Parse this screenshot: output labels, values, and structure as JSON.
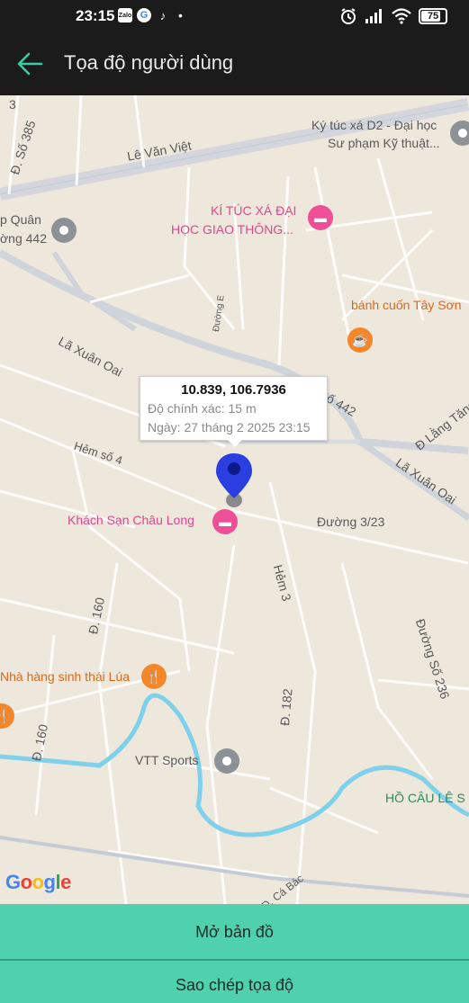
{
  "status_bar": {
    "time": "23:15",
    "app_icons": [
      "zalo-icon",
      "google-icon",
      "tiktok-icon"
    ],
    "zalo_label": "Zalo",
    "google_letter": "G",
    "battery": "75"
  },
  "header": {
    "title": "Tọa độ người dùng",
    "back_icon": "arrow-left-icon"
  },
  "map": {
    "callout": {
      "coordinates": "10.839, 106.7936",
      "accuracy": "Độ chính xác: 15 m",
      "date": "Ngày: 27 tháng 2 2025 23:15"
    },
    "labels": {
      "le_van_viet": "Lê Văn Việt",
      "duong_so_385": "Đ. Số 385",
      "num_3": "3",
      "ky_tuc_xa_d2_1": "Ký túc xá D2 - Đại học",
      "ky_tuc_xa_d2_2": "Sư phạm Kỹ thuật...",
      "ktx_gtvt_1": "KÍ TÚC XÁ ĐẠI",
      "ktx_gtvt_2": "HỌC GIAO THÔNG...",
      "p_quan_1": "p Quân",
      "p_quan_2": "ờng 442",
      "banh_cuon": "bánh cuốn Tây Sơn",
      "duong_e": "Đường E",
      "la_xuan_oai_1": "Lã Xuân Oai",
      "so_442": "số 442",
      "d_lang_tang_phu": "Đ Lã̀ng Tăng Ph",
      "la_xuan_oai_2": "Lã Xuân Oai",
      "hem_so_4": "Hẻm số 4",
      "khach_san": "Khách Sạn Châu Long",
      "duong_3_23": "Đường 3/23",
      "hem_3": "Hẻm 3",
      "d_160_1": "Đ. 160",
      "duong_so_236": "Đường Số 236",
      "nha_hang": "Nhà hàng sinh thái Lúa",
      "d_182": "Đ. 182",
      "d_160_2": "Đ. 160",
      "vtt_sports": "VTT Sports",
      "ho_cau": "HỒ CÂU LÊ S",
      "d_ca_bac": "Đ. Cá Bác"
    },
    "attribution": "Google"
  },
  "buttons": {
    "open_map": "Mở bản đồ",
    "copy_coordinates": "Sao chép tọa độ"
  },
  "colors": {
    "accent": "#4fd1ad",
    "map_background": "#ede7dc",
    "river": "#7fd0ea",
    "pin": "#2b3fe0"
  }
}
